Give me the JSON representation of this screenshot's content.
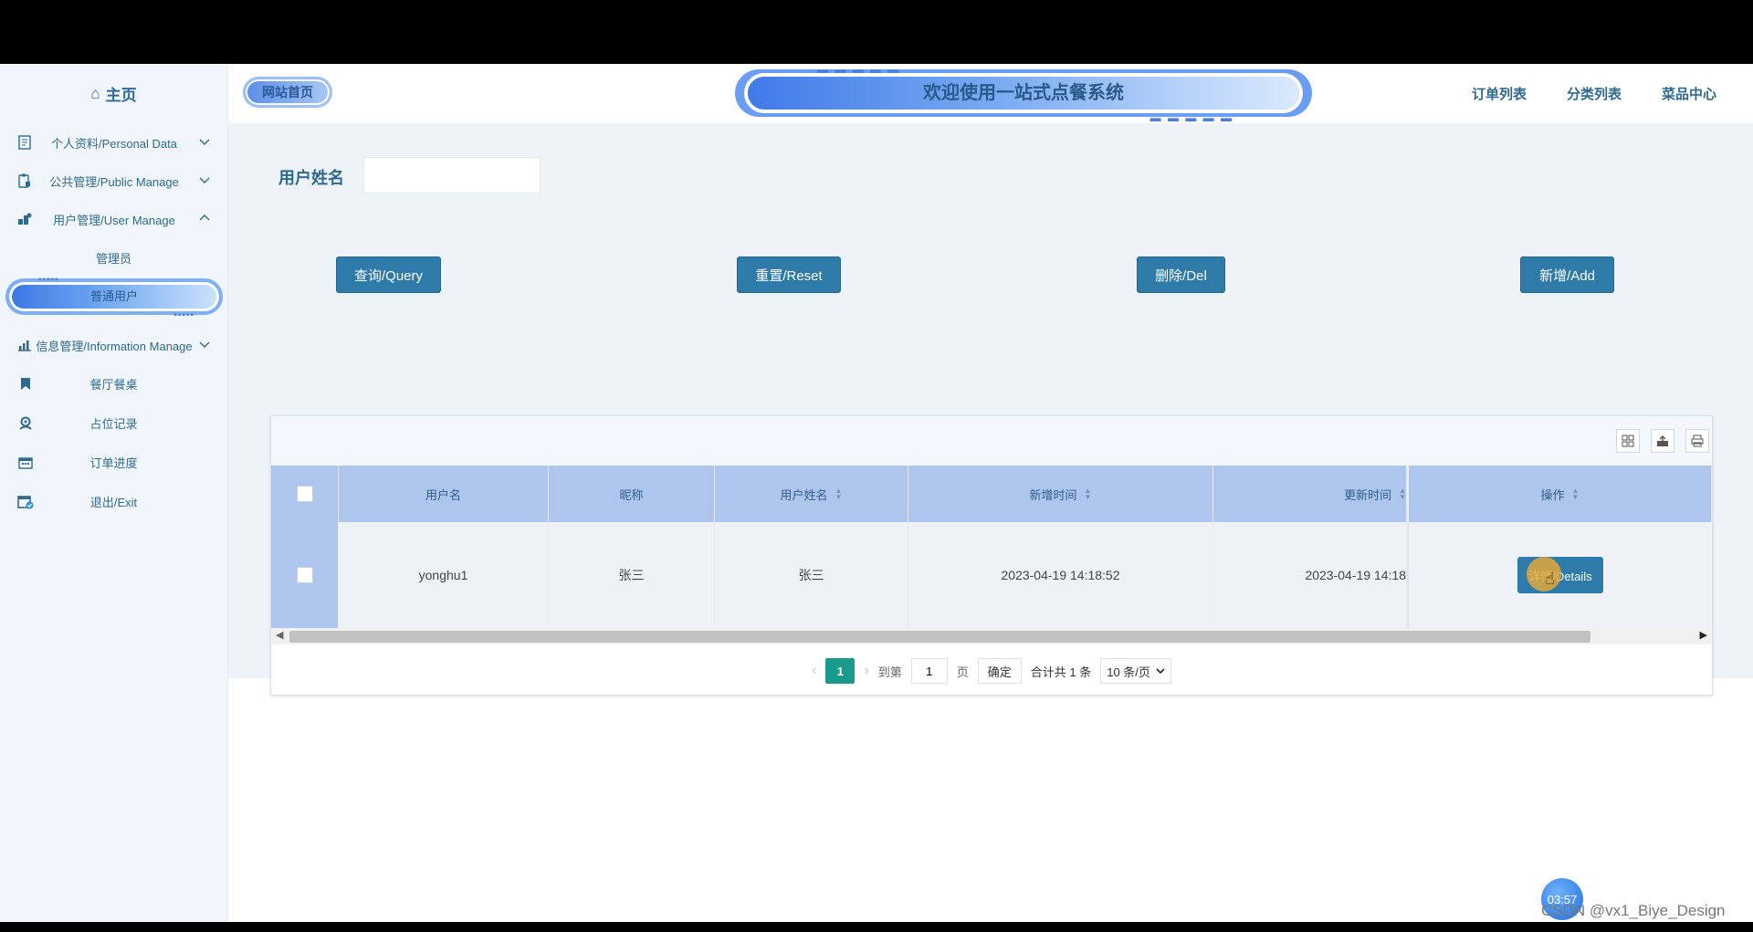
{
  "sidebar": {
    "home_label": "主页",
    "groups": [
      {
        "label": "个人资料/Personal Data",
        "icon": "document-icon"
      },
      {
        "label": "公共管理/Public Manage",
        "icon": "clipboard-lock-icon"
      },
      {
        "label": "用户管理/User Manage",
        "icon": "user-manage-icon"
      }
    ],
    "sub_items": [
      {
        "label": "管理员"
      },
      {
        "label": "普通用户",
        "active": true
      }
    ],
    "info_group": {
      "label": "信息管理/Information Manage",
      "icon": "chart-icon"
    },
    "items": [
      {
        "label": "餐厅餐桌",
        "icon": "bookmark-icon"
      },
      {
        "label": "占位记录",
        "icon": "user-badge-icon"
      },
      {
        "label": "订单进度",
        "icon": "calendar-icon"
      },
      {
        "label": "退出/Exit",
        "icon": "calendar-check-icon"
      }
    ]
  },
  "header": {
    "home_link": "网站首页",
    "welcome": "欢迎使用一站式点餐系统",
    "nav": [
      "订单列表",
      "分类列表",
      "菜品中心"
    ]
  },
  "search": {
    "label": "用户姓名",
    "value": "",
    "placeholder": ""
  },
  "buttons": {
    "query": "查询/Query",
    "reset": "重置/Reset",
    "delete": "删除/Del",
    "add": "新增/Add"
  },
  "table": {
    "toolbar_icons": [
      "columns-icon",
      "export-icon",
      "print-icon"
    ],
    "columns": [
      "用户名",
      "昵称",
      "用户姓名",
      "新增时间",
      "更新时间",
      "操作"
    ],
    "rows": [
      {
        "username": "yonghu1",
        "nickname": "张三",
        "realname": "张三",
        "created": "2023-04-19 14:18:52",
        "updated": "2023-04-19 14:18",
        "action": "详情/Details"
      }
    ]
  },
  "pager": {
    "current_page": "1",
    "goto_prefix": "到第",
    "goto_value": "1",
    "goto_suffix": "页",
    "confirm": "确定",
    "total": "合计共 1 条",
    "page_size": "10 条/页"
  },
  "overlay": {
    "timer": "03:57",
    "watermark": "CSDN @vx1_Biye_Design"
  },
  "colors": {
    "primary": "#2e7aa8",
    "active_page": "#1a9a8a",
    "header_row": "#aec5ee",
    "sidebar_text": "#2f6a8e"
  }
}
